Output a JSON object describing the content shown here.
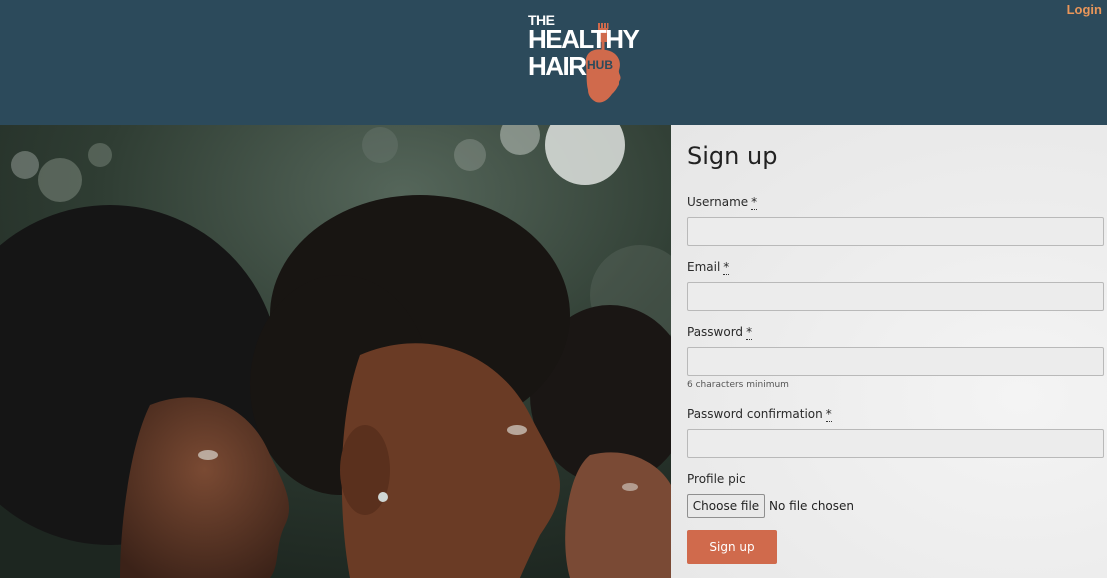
{
  "header": {
    "login_label": "Login",
    "logo": {
      "line1": "THE",
      "line2": "HEALTHY",
      "line3": "HAIR",
      "badge": "HUB"
    }
  },
  "form": {
    "title": "Sign up",
    "required_marker": "*",
    "fields": [
      {
        "label": "Username",
        "required": true,
        "value": ""
      },
      {
        "label": "Email",
        "required": true,
        "value": ""
      },
      {
        "label": "Password",
        "required": true,
        "value": "",
        "hint": "6 characters minimum"
      },
      {
        "label": "Password confirmation",
        "required": true,
        "value": ""
      }
    ],
    "profile_pic": {
      "label": "Profile pic",
      "button_label": "Choose file",
      "status": "No file chosen"
    },
    "submit_label": "Sign up"
  },
  "colors": {
    "header_bg": "#2c4a5b",
    "accent": "#d06a4c",
    "login": "#e9965a"
  }
}
